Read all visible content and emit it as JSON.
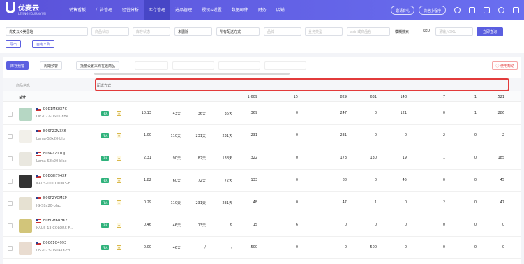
{
  "app": {
    "brand": "优麦云",
    "brand_sub": "LEYING YOUMAIYUN"
  },
  "nav": [
    {
      "label": "销售看板"
    },
    {
      "label": "广告管理"
    },
    {
      "label": "经营分析"
    },
    {
      "label": "库存管理",
      "active": true
    },
    {
      "label": "选品管理"
    },
    {
      "label": "授权&设置"
    },
    {
      "label": "数据邮件"
    },
    {
      "label": "财务"
    },
    {
      "label": "店铺"
    }
  ],
  "header_right": {
    "invite": "邀请有礼",
    "mini_app": "微信小程序"
  },
  "filters": {
    "shop": "优麦云K-美国站",
    "f2": "商品状态",
    "f3": "库存状态",
    "deleted": "未删除",
    "delivery": "所有配送方式",
    "f6": "品牌",
    "f7": "业务类型",
    "f8": "asin或商品名",
    "fuzzy": "模糊搜索",
    "sku_label": "SKU",
    "sku_placeholder": "请输入SKU",
    "search_btn": "立即查询",
    "export_btn": "导出",
    "custom_btn": "自定义列"
  },
  "toolbar": {
    "b1": "库存预警",
    "b2": "周期预警",
    "b3": "批量设置采购在途商品",
    "b4": "",
    "b5": "",
    "b6": "",
    "b7": "",
    "help": "使用帮助"
  },
  "table": {
    "left_header": "商品信息",
    "headers": [
      "配送方式",
      "",
      "",
      "",
      "",
      "",
      "",
      "",
      "",
      "",
      "",
      "",
      "",
      ""
    ],
    "total_label": "总计",
    "totals": [
      "1,609",
      "15",
      "829",
      "631",
      "148",
      "7",
      "1",
      "521"
    ],
    "rows": [
      {
        "asin": "B0B1MK8X7C",
        "sku": "OP2022-US01-FBA",
        "v": [
          "10.13",
          "43天",
          "36天",
          "36天",
          "369",
          "0",
          "247",
          "0",
          "121",
          "0",
          "1",
          "286"
        ]
      },
      {
        "asin": "B09PZZV3X6",
        "sku": "Lama-S8x20-blu",
        "v": [
          "1.00",
          "110天",
          "231天",
          "231天",
          "231",
          "0",
          "231",
          "0",
          "0",
          "2",
          "0",
          "2"
        ]
      },
      {
        "asin": "B09PZZT1DJ",
        "sku": "Lama-S8x20-blac",
        "v": [
          "2.31",
          "90天",
          "82天",
          "138天",
          "322",
          "0",
          "173",
          "130",
          "19",
          "1",
          "0",
          "185"
        ]
      },
      {
        "asin": "B0BGH794XP",
        "sku": "KAUS-10 COLORS-F...",
        "v": [
          "1.82",
          "60天",
          "72天",
          "72天",
          "133",
          "0",
          "88",
          "0",
          "45",
          "0",
          "0",
          "45"
        ]
      },
      {
        "asin": "B09PZYDMSP",
        "sku": "IG-S8x20-blac",
        "v": [
          "0.29",
          "110天",
          "231天",
          "231天",
          "48",
          "0",
          "47",
          "1",
          "0",
          "2",
          "0",
          "47"
        ]
      },
      {
        "asin": "B0BGH6NHKZ",
        "sku": "KAUS-13 COLORS-F...",
        "v": [
          "0.46",
          "46天",
          "13天",
          "6",
          "15",
          "6",
          "0",
          "0",
          "0",
          "0",
          "0",
          "0"
        ]
      },
      {
        "asin": "B0C61Q4993",
        "sku": "DS2023-US04KY-FB...",
        "v": [
          "0.00",
          "46天",
          "/",
          "/",
          "500",
          "0",
          "0",
          "500",
          "0",
          "0",
          "0",
          "0"
        ]
      }
    ]
  }
}
